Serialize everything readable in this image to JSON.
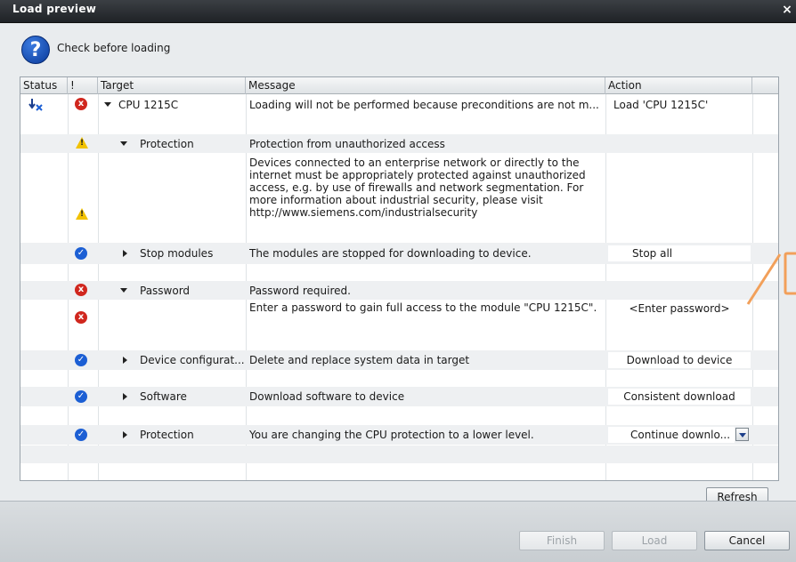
{
  "dialog": {
    "title": "Load preview",
    "close_glyph": "×",
    "header_text": "Check before loading"
  },
  "columns": [
    "Status",
    "!",
    "Target",
    "Message",
    "Action"
  ],
  "rows": [
    {
      "target": "CPU 1215C",
      "message": "Loading will not be performed because preconditions are not m...",
      "action": "Load 'CPU 1215C'"
    },
    {
      "target": "Protection",
      "message": "Protection from unauthorized access"
    },
    {
      "message": "Devices connected to an enterprise network or directly to the internet must be appropriately protected against unauthorized access, e.g. by use of firewalls and network segmentation. For more information about industrial security, please visit http://www.siemens.com/industrialsecurity"
    },
    {
      "target": "Stop modules",
      "message": "The modules are stopped for downloading to device.",
      "action": "Stop all"
    },
    {
      "target": "Password",
      "message": "Password required."
    },
    {
      "message": "Enter a password to gain full access to the module \"CPU 1215C\".",
      "action": "<Enter password>"
    },
    {
      "target": "Device configurat...",
      "message": "Delete and replace system data in target",
      "action": "Download to device"
    },
    {
      "target": "Software",
      "message": "Download software to device",
      "action": "Consistent download"
    },
    {
      "target": "Protection",
      "message": "You are changing the CPU protection to a lower level.",
      "action": "Continue downlo..."
    }
  ],
  "buttons": {
    "refresh": "Refresh",
    "finish": "Finish",
    "load": "Load",
    "cancel": "Cancel"
  },
  "icons": {
    "help": "?",
    "error": "x",
    "ok": "✓",
    "warning": "!"
  },
  "colors": {
    "error": "#d0271e",
    "ok": "#1c5fd4",
    "warning": "#f2c200",
    "callout": "#f2a05a"
  }
}
